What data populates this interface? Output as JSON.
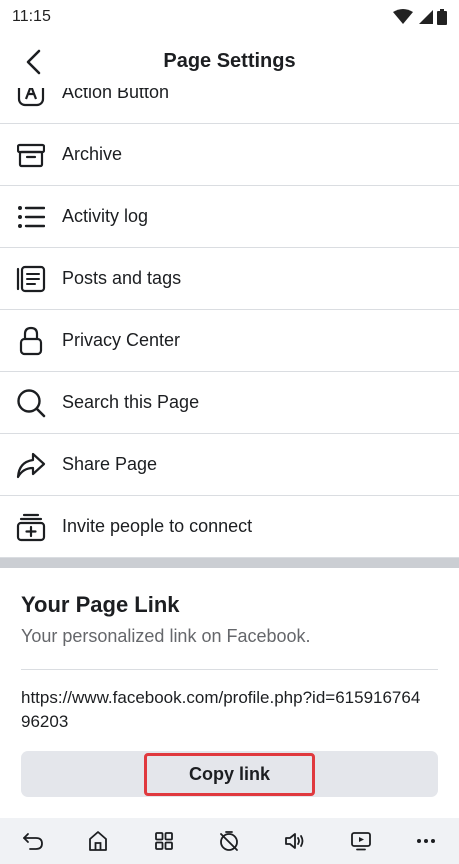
{
  "status_bar": {
    "time": "11:15"
  },
  "header": {
    "title": "Page Settings"
  },
  "menu": {
    "items": [
      {
        "label": "Action Button",
        "icon": "action-button-icon"
      },
      {
        "label": "Archive",
        "icon": "archive-icon"
      },
      {
        "label": "Activity log",
        "icon": "activity-log-icon"
      },
      {
        "label": "Posts and tags",
        "icon": "posts-tags-icon"
      },
      {
        "label": "Privacy Center",
        "icon": "lock-icon"
      },
      {
        "label": "Search this Page",
        "icon": "search-icon"
      },
      {
        "label": "Share Page",
        "icon": "share-icon"
      },
      {
        "label": "Invite people to connect",
        "icon": "invite-icon"
      }
    ]
  },
  "page_link": {
    "title": "Your Page Link",
    "subtitle": "Your personalized link on Facebook.",
    "url": "https://www.facebook.com/profile.php?id=61591676496203",
    "copy_label": "Copy link"
  },
  "colors": {
    "highlight": "#e0393e",
    "button_bg": "#e4e6eb",
    "separator": "#cbced3"
  }
}
